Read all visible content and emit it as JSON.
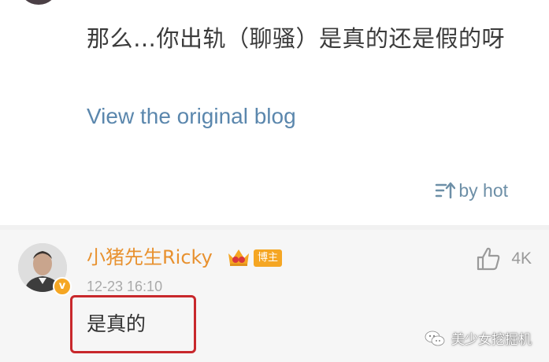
{
  "post": {
    "text": "那么…你出轨（聊骚）是真的还是假的呀",
    "view_original_label": "View the original blog"
  },
  "sort": {
    "label": "by hot",
    "icon": "sort-icon"
  },
  "comment": {
    "username": "小猪先生Ricky",
    "role_badge": "博主",
    "timestamp": "12-23 16:10",
    "text": "是真的",
    "like_count": "4K",
    "verified": true,
    "highlight_color": "#c8282c"
  },
  "watermark": {
    "label": "美少女挖掘机",
    "icon": "wechat-icon"
  },
  "colors": {
    "link": "#5b87ad",
    "username": "#e8912f",
    "badge": "#f5a623"
  }
}
